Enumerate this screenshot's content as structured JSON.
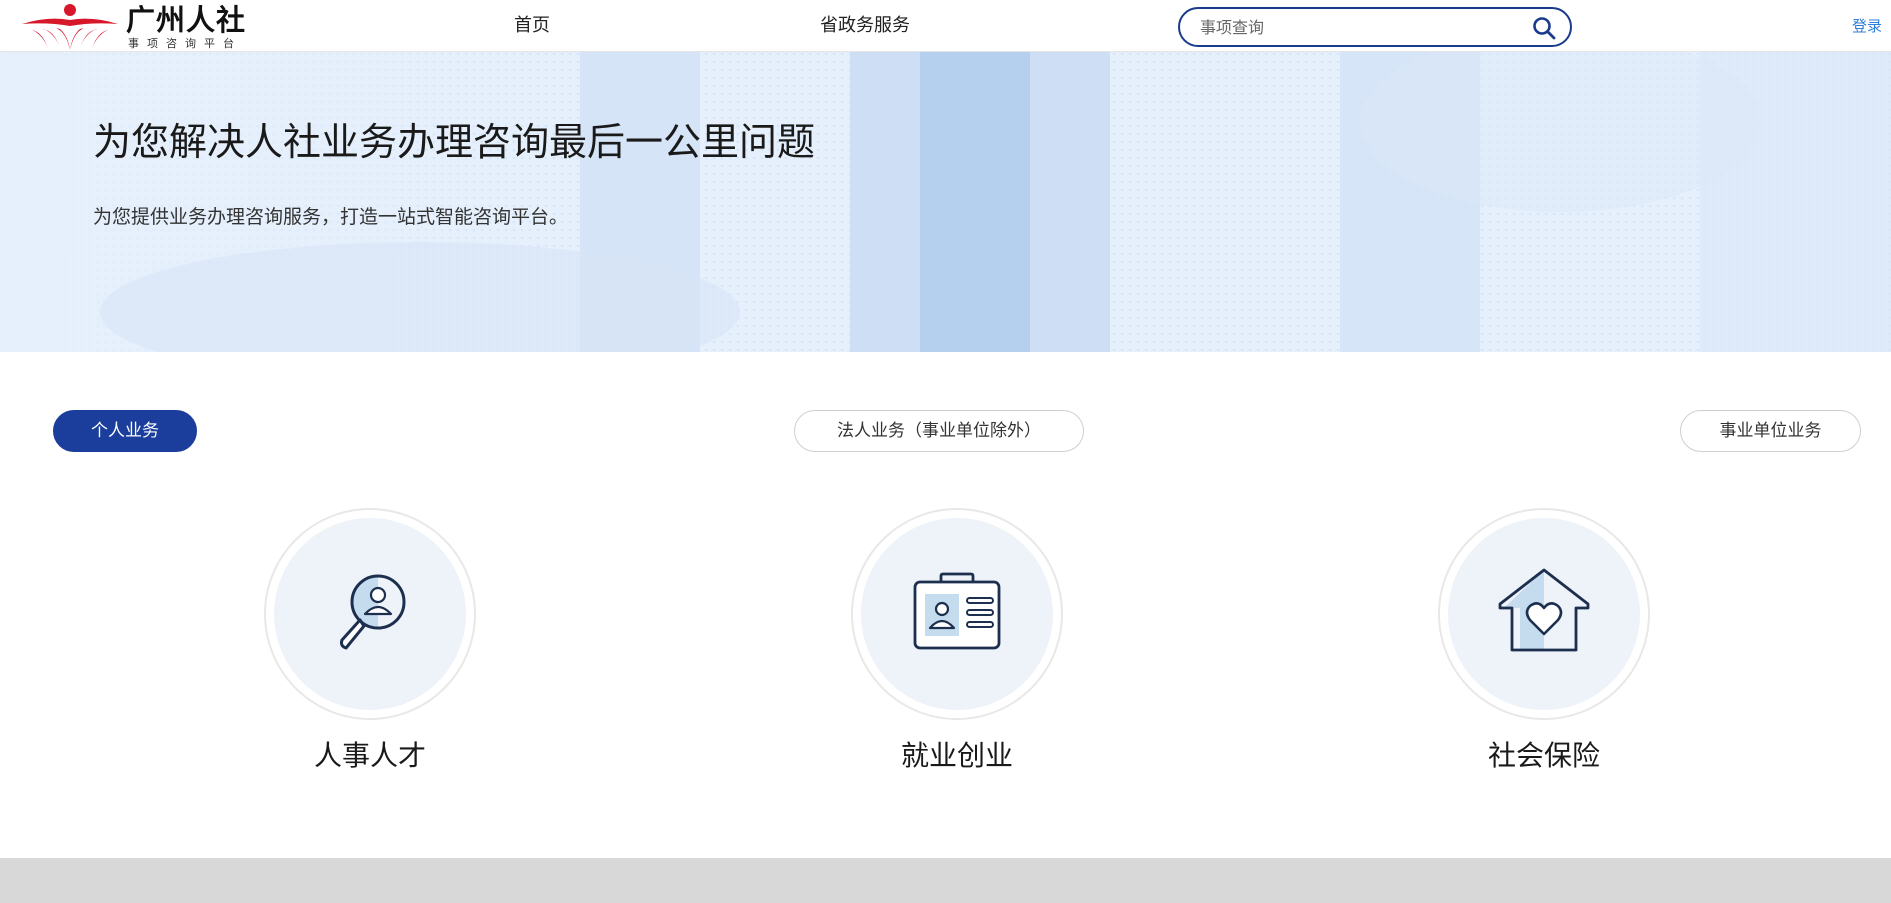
{
  "header": {
    "logo_title": "广州人社",
    "logo_subtitle": "事项咨询平台",
    "nav": {
      "home": "首页",
      "gov_services": "省政务服务"
    },
    "search": {
      "placeholder": "事项查询",
      "value": ""
    },
    "login": "登录"
  },
  "hero": {
    "title": "为您解决人社业务办理咨询最后一公里问题",
    "subtitle": "为您提供业务办理咨询服务，打造一站式智能咨询平台。"
  },
  "tabs": [
    {
      "label": "个人业务",
      "active": true
    },
    {
      "label": "法人业务（事业单位除外）",
      "active": false
    },
    {
      "label": "事业单位业务",
      "active": false
    }
  ],
  "categories": [
    {
      "label": "人事人才",
      "icon": "magnifier-person-icon"
    },
    {
      "label": "就业创业",
      "icon": "id-card-icon"
    },
    {
      "label": "社会保险",
      "icon": "house-heart-icon"
    }
  ],
  "colors": {
    "brand_navy": "#1b3e9c",
    "search_border": "#1a3a8c",
    "login_link": "#2f7fd8",
    "logo_red": "#d7182a",
    "hero_bg": "#e6f0fc",
    "icon_stroke": "#1d2f4f",
    "icon_fill": "#c5dcee"
  }
}
